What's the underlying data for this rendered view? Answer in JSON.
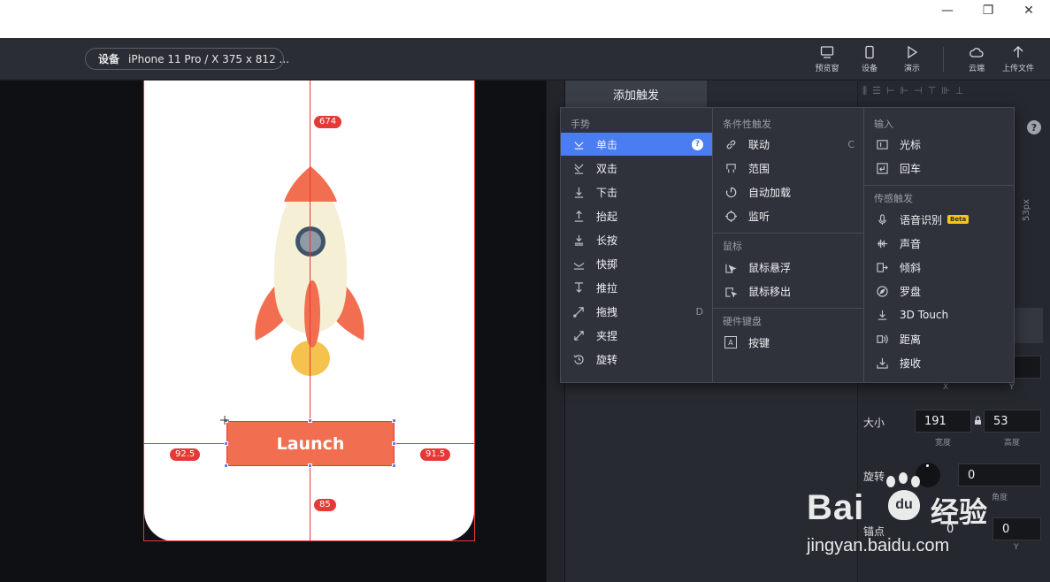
{
  "window": {
    "minimize": "—",
    "maximize": "❐",
    "close": "✕"
  },
  "toolbar": {
    "device_label": "设备",
    "device_value": "iPhone 11 Pro / X  375 x 812 ...",
    "buttons": [
      {
        "label": "预览窗",
        "icon": "monitor-icon"
      },
      {
        "label": "设备",
        "icon": "phone-icon"
      },
      {
        "label": "演示",
        "icon": "play-icon"
      },
      {
        "label": "云端",
        "icon": "cloud-icon"
      },
      {
        "label": "上传文件",
        "icon": "upload-icon"
      }
    ]
  },
  "canvas": {
    "button_label": "Launch",
    "measure_top": "674",
    "measure_left": "92.5",
    "measure_right": "91.5",
    "measure_bottom": "85",
    "colors": {
      "rocket_body": "#f5efd6",
      "rocket_red": "#f26e50",
      "flame": "#f4c24d",
      "window": "#3f5468"
    }
  },
  "panel": {
    "tab": "添加触发",
    "help": "?",
    "height_partial": "53px",
    "size_label": "大小",
    "width_value": "191",
    "width_caption": "宽度",
    "height_value": "53",
    "height_caption": "高度",
    "x_caption": "X",
    "y_caption": "Y",
    "rotate_label": "旋转",
    "rotate_value": "0",
    "rotate_caption": "角度",
    "anchor_label": "锚点",
    "anchor_x": "0",
    "anchor_y": "0",
    "anchor_y_caption": "Y"
  },
  "menu": {
    "gesture": {
      "header": "手势",
      "items": [
        {
          "label": "单击",
          "icon": "tap-icon",
          "selected": true,
          "help": "?"
        },
        {
          "label": "双击",
          "icon": "double-tap-icon"
        },
        {
          "label": "下击",
          "icon": "touch-down-icon"
        },
        {
          "label": "抬起",
          "icon": "touch-up-icon"
        },
        {
          "label": "长按",
          "icon": "long-press-icon"
        },
        {
          "label": "快掷",
          "icon": "flick-icon"
        },
        {
          "label": "推拉",
          "icon": "push-pull-icon"
        },
        {
          "label": "拖拽",
          "icon": "drag-icon",
          "key": "D"
        },
        {
          "label": "夹捏",
          "icon": "pinch-icon"
        },
        {
          "label": "旋转",
          "icon": "rotate-icon"
        }
      ]
    },
    "conditional": {
      "header": "条件性触发",
      "items": [
        {
          "label": "联动",
          "icon": "link-icon",
          "key": "C"
        },
        {
          "label": "范围",
          "icon": "range-icon"
        },
        {
          "label": "自动加载",
          "icon": "autoload-icon"
        },
        {
          "label": "监听",
          "icon": "listen-icon"
        }
      ],
      "mouse_header": "鼠标",
      "mouse_items": [
        {
          "label": "鼠标悬浮",
          "icon": "mouse-hover-icon"
        },
        {
          "label": "鼠标移出",
          "icon": "mouse-out-icon"
        }
      ],
      "keyboard_header": "硬件键盘",
      "keyboard_items": [
        {
          "label": "按键",
          "icon": "key-icon",
          "glyph": "A"
        }
      ]
    },
    "input": {
      "header": "输入",
      "items": [
        {
          "label": "光标",
          "icon": "cursor-icon"
        },
        {
          "label": "回车",
          "icon": "enter-icon"
        }
      ],
      "sensor_header": "传感触发",
      "sensor_items": [
        {
          "label": "语音识别",
          "icon": "mic-icon",
          "badge": "Beta"
        },
        {
          "label": "声音",
          "icon": "sound-icon"
        },
        {
          "label": "倾斜",
          "icon": "tilt-icon"
        },
        {
          "label": "罗盘",
          "icon": "compass-icon"
        },
        {
          "label": "3D Touch",
          "icon": "3d-touch-icon"
        },
        {
          "label": "距离",
          "icon": "distance-icon"
        },
        {
          "label": "接收",
          "icon": "receive-icon"
        }
      ]
    }
  },
  "watermark": {
    "brand": "Bai",
    "paw": "du",
    "cn": "经验",
    "url": "jingyan.baidu.com"
  }
}
